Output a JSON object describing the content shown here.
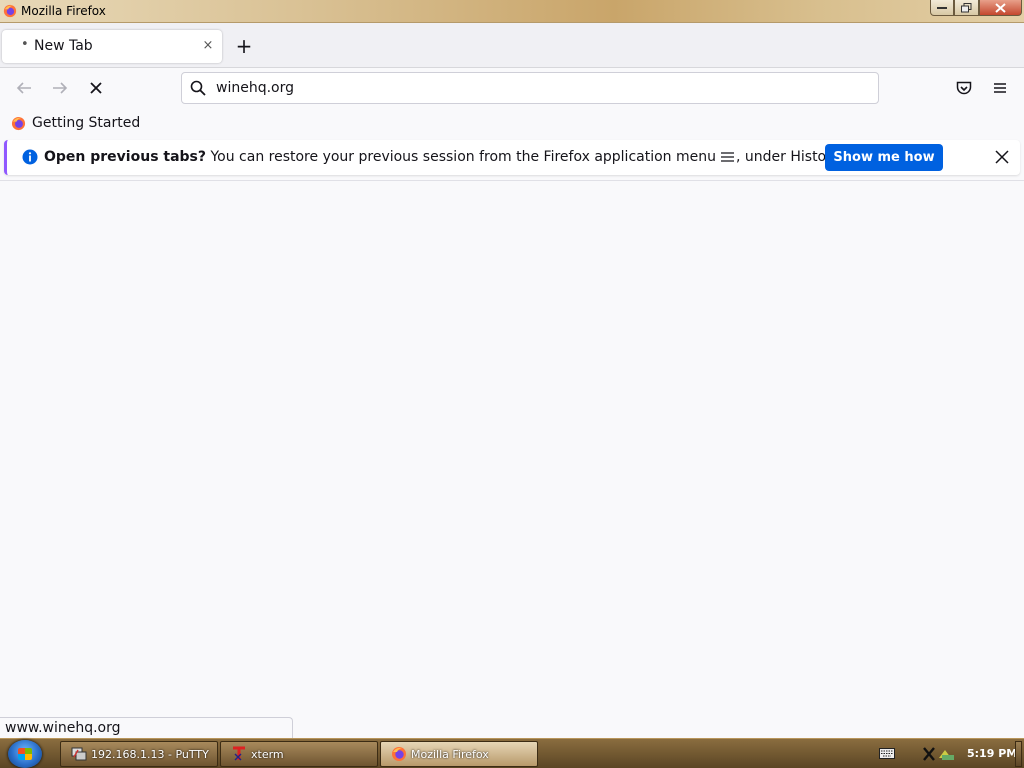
{
  "window": {
    "title": "Mozilla Firefox",
    "icon": "firefox-icon"
  },
  "tabs": [
    {
      "label": "New Tab",
      "loading_indicator": "•",
      "close_glyph": "×"
    }
  ],
  "new_tab_glyph": "+",
  "navbar": {
    "back_icon": "arrow-left-icon",
    "forward_icon": "arrow-right-icon",
    "stop_icon": "stop-icon",
    "url": "winehq.org",
    "pocket_icon": "pocket-icon",
    "menu_icon": "hamburger-menu-icon"
  },
  "bookmarks": [
    {
      "label": "Getting Started",
      "icon": "firefox-icon"
    }
  ],
  "notification": {
    "title": "Open previous tabs?",
    "message_before": " You can restore your previous session from the Firefox application menu",
    "message_after": ", under History.",
    "button_label": "Show me how",
    "accent_color": "#9059ff",
    "button_color": "#0061e0"
  },
  "status": {
    "link": "www.winehq.org"
  },
  "taskbar": {
    "items": [
      {
        "label": "192.168.1.13 - PuTTY",
        "icon": "putty-icon"
      },
      {
        "label": "xterm",
        "icon": "xterm-icon"
      },
      {
        "label": "Mozilla Firefox",
        "icon": "firefox-icon"
      }
    ],
    "clock": "5:19 PM"
  }
}
